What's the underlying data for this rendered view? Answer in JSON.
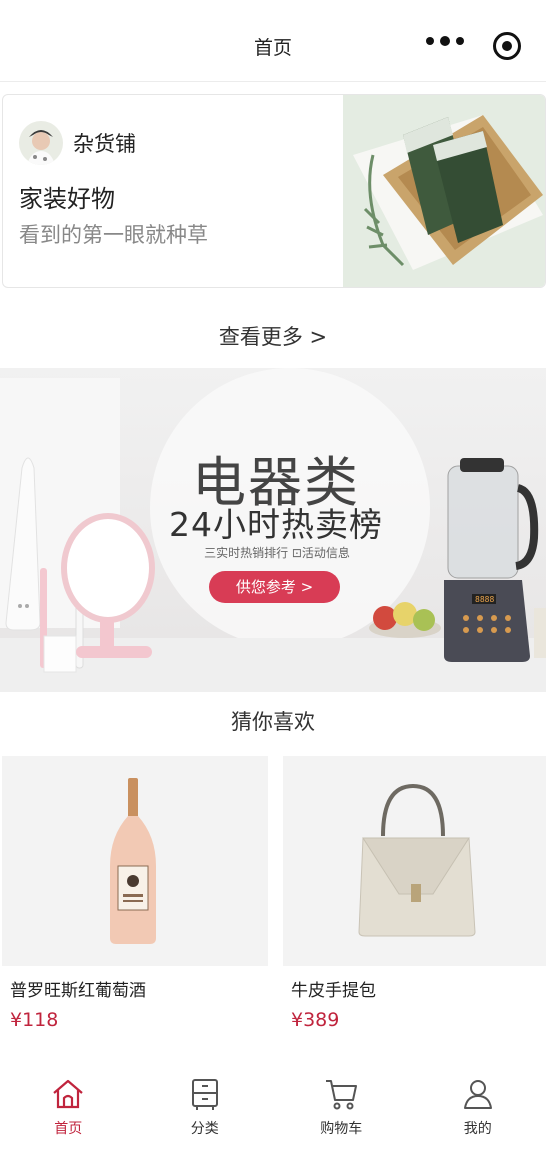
{
  "header": {
    "title": "首页"
  },
  "store": {
    "name": "杂货铺",
    "title": "家装好物",
    "subtitle": "看到的第一眼就种草"
  },
  "view_more": "查看更多 >",
  "banner": {
    "title": "电器类",
    "subtitle": "24小时热卖榜",
    "tags": "三实时热销排行  ⊡活动信息",
    "button": "供您参考 >"
  },
  "recommend": {
    "title": "猜你喜欢",
    "products": [
      {
        "name": "普罗旺斯红葡萄酒",
        "price": "¥118"
      },
      {
        "name": "牛皮手提包",
        "price": "¥389"
      }
    ]
  },
  "tabbar": {
    "items": [
      {
        "label": "首页",
        "icon": "home-icon",
        "active": true
      },
      {
        "label": "分类",
        "icon": "category-icon",
        "active": false
      },
      {
        "label": "购物车",
        "icon": "cart-icon",
        "active": false
      },
      {
        "label": "我的",
        "icon": "user-icon",
        "active": false
      }
    ]
  },
  "colors": {
    "accent": "#c0243d",
    "button": "#d83c55"
  }
}
